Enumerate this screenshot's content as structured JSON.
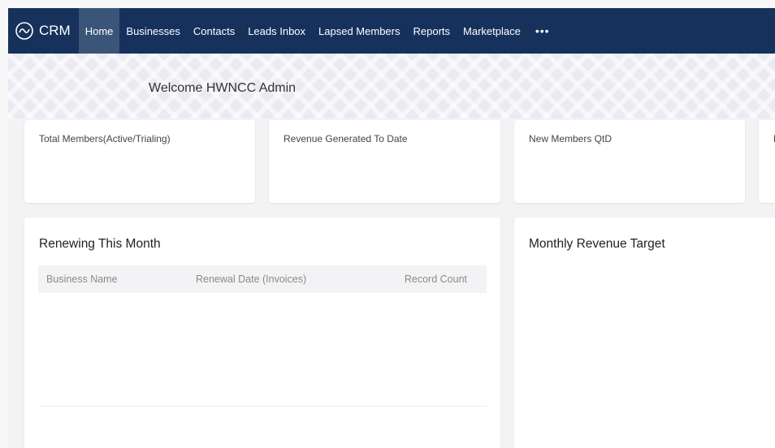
{
  "app": {
    "brand": "CRM",
    "brand_icon": "crm-logo-icon"
  },
  "nav": {
    "items": [
      {
        "label": "Home",
        "active": true
      },
      {
        "label": "Businesses"
      },
      {
        "label": "Contacts"
      },
      {
        "label": "Leads Inbox"
      },
      {
        "label": "Lapsed Members"
      },
      {
        "label": "Reports"
      },
      {
        "label": "Marketplace"
      }
    ],
    "more": "•••"
  },
  "welcome": "Welcome HWNCC Admin",
  "kpis": [
    {
      "label": "Total Members(Active/Trialing)"
    },
    {
      "label": "Revenue Generated To Date"
    },
    {
      "label": "New Members QtD"
    },
    {
      "label": "N"
    }
  ],
  "renewing": {
    "title": "Renewing This Month",
    "columns": [
      "Business Name",
      "Renewal Date (Invoices)",
      "Record Count"
    ]
  },
  "revenue_target": {
    "title": "Monthly Revenue Target"
  },
  "colors": {
    "navbar": "#16325c",
    "nav_active": "#3b5578",
    "background": "#f3f3f5"
  }
}
